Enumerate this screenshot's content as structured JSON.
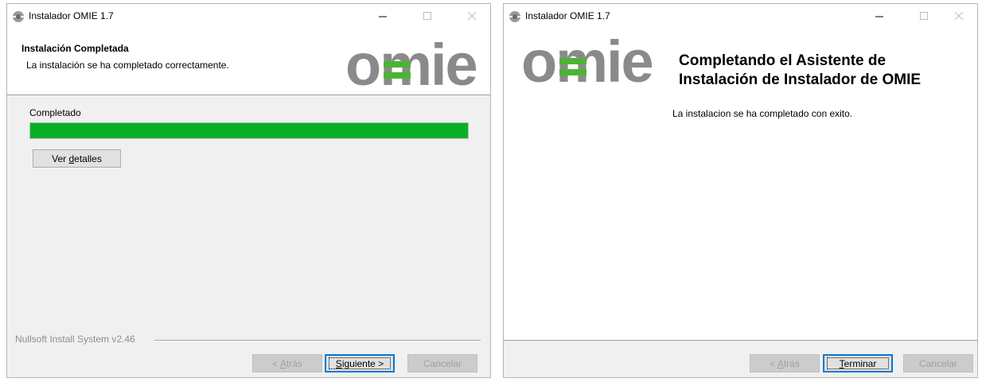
{
  "window1": {
    "title": "Instalador OMIE 1.7",
    "header_title": "Instalación Completada",
    "header_subtitle": "La instalación se ha completado correctamente.",
    "logo_text": "omie",
    "progress_label": "Completado",
    "progress_percent": 100,
    "details_button": {
      "pre": "Ver ",
      "mnemonic": "d",
      "post": "etalles"
    },
    "branding": "Nullsoft Install System v2.46",
    "back_button": {
      "pre": "< ",
      "mnemonic": "A",
      "post": "trás",
      "enabled": false
    },
    "next_button": {
      "pre": "",
      "mnemonic": "S",
      "post": "iguiente >",
      "default": true
    },
    "cancel_button": {
      "pre": "",
      "mnemonic": "",
      "post": "Cancelar",
      "enabled": false
    }
  },
  "window2": {
    "title": "Instalador OMIE 1.7",
    "logo_text": "omie",
    "welcome_title_line1": "Completando el Asistente de",
    "welcome_title_line2": "Instalación de Instalador de OMIE",
    "welcome_body": "La instalacion se ha completado con exito.",
    "back_button": {
      "pre": "< ",
      "mnemonic": "A",
      "post": "trás",
      "enabled": false
    },
    "finish_button": {
      "pre": "",
      "mnemonic": "T",
      "post": "erminar",
      "default": true
    },
    "cancel_button": {
      "pre": "",
      "mnemonic": "",
      "post": "Cancelar",
      "enabled": false
    }
  },
  "icons": {
    "app": "omie-app-icon",
    "minimize": "minimize-icon",
    "maximize": "maximize-icon",
    "close": "close-icon"
  },
  "colors": {
    "progress_fill": "#06b025",
    "logo_gray": "#8a8a8a",
    "logo_green": "#4cb432",
    "default_button_border": "#0078d7"
  }
}
